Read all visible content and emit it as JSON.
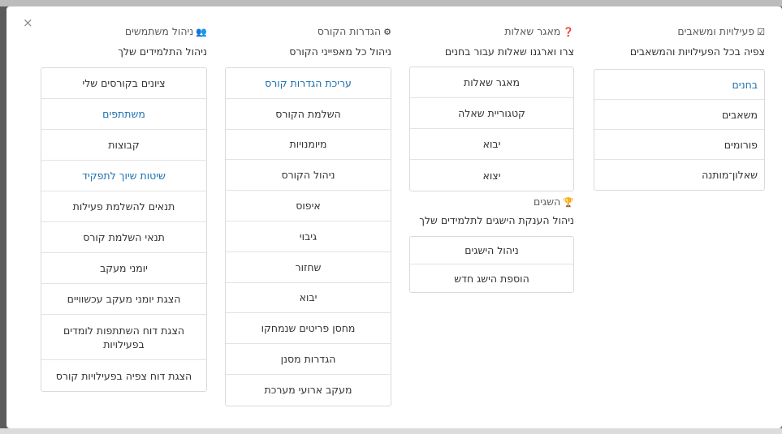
{
  "modal": {
    "close_label": "×"
  },
  "columns": {
    "activities": {
      "title": "פעילויות ומשאבים",
      "icon": "check-square-icon",
      "description": "צפיה בכל הפעילויות והמשאבים",
      "items": [
        {
          "label": "בחנים",
          "link": true
        },
        {
          "label": "משאבים",
          "link": false
        },
        {
          "label": "פורומים",
          "link": false
        },
        {
          "label": "שאלון־מותנה",
          "link": false
        }
      ]
    },
    "question_bank": {
      "title": "מאגר שאלות",
      "icon": "question-circle-icon",
      "description": "צרו וארגנו שאלות עבור בחנים",
      "items": [
        {
          "label": "מאגר שאלות",
          "link": false
        },
        {
          "label": "קטגוריית שאלה",
          "link": false
        },
        {
          "label": "יבוא",
          "link": false
        },
        {
          "label": "יצוא",
          "link": false
        }
      ]
    },
    "badges": {
      "title": "השגים",
      "icon": "trophy-icon",
      "description": "ניהול הענקת הישגים לתלמידים שלך",
      "items": [
        {
          "label": "ניהול הישגים",
          "link": false
        },
        {
          "label": "הוספת הישג חדש",
          "link": false
        }
      ]
    },
    "course_settings": {
      "title": "הגדרות הקורס",
      "icon": "cogs-icon",
      "description": "ניהול כל מאפייני הקורס",
      "items": [
        {
          "label": "עריכת הגדרות קורס",
          "link": true
        },
        {
          "label": "השלמת הקורס",
          "link": false
        },
        {
          "label": "מיומנויות",
          "link": false
        },
        {
          "label": "ניהול הקורס",
          "link": false
        },
        {
          "label": "איפוס",
          "link": false
        },
        {
          "label": "גיבוי",
          "link": false
        },
        {
          "label": "שחזור",
          "link": false
        },
        {
          "label": "יבוא",
          "link": false
        },
        {
          "label": "מחסן פריטים שנמחקו",
          "link": false
        },
        {
          "label": "הגדרות מסנן",
          "link": false
        },
        {
          "label": "מעקב ארועי מערכת",
          "link": false
        }
      ]
    },
    "users": {
      "title": "ניהול משתמשים",
      "icon": "users-icon",
      "description": "ניהול התלמידים שלך",
      "items": [
        {
          "label": "ציונים בקורסים שלי",
          "link": false
        },
        {
          "label": "משתתפים",
          "link": true
        },
        {
          "label": "קבוצות",
          "link": false
        },
        {
          "label": "שיטות שיוך לתפקיד",
          "link": true
        },
        {
          "label": "תנאים להשלמת פעילות",
          "link": false
        },
        {
          "label": "תנאי השלמת קורס",
          "link": false
        },
        {
          "label": "יומני מעקב",
          "link": false
        },
        {
          "label": "הצגת יומני מעקב עכשוויים",
          "link": false
        },
        {
          "label": "הצגת דוח השתתפות לומדים בפעילויות",
          "link": false
        },
        {
          "label": "הצגת דוח צפיה בפעילויות קורס",
          "link": false
        }
      ]
    }
  }
}
